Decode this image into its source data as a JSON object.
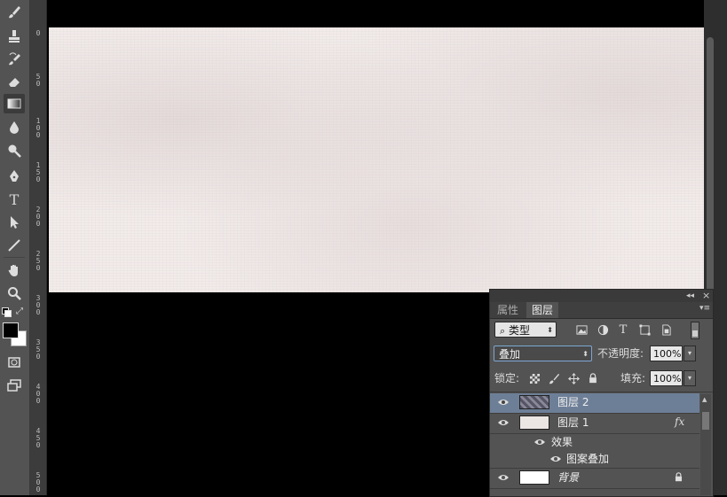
{
  "toolbar": {
    "tools": [
      {
        "name": "brush-tool",
        "icon": "brush-icon"
      },
      {
        "name": "clone-stamp-tool",
        "icon": "stamp-icon"
      },
      {
        "name": "history-brush-tool",
        "icon": "history-brush-icon"
      },
      {
        "name": "eraser-tool",
        "icon": "eraser-icon"
      },
      {
        "name": "gradient-tool",
        "icon": "gradient-icon"
      },
      {
        "name": "blur-tool",
        "icon": "drop-icon"
      },
      {
        "name": "dodge-tool",
        "icon": "dodge-icon"
      },
      {
        "name": "pen-tool",
        "icon": "pen-icon"
      },
      {
        "name": "type-tool",
        "icon": "type-icon",
        "glyph": "T"
      },
      {
        "name": "path-selection-tool",
        "icon": "arrow-icon"
      },
      {
        "name": "line-tool",
        "icon": "line-icon"
      },
      {
        "name": "hand-tool",
        "icon": "hand-icon"
      },
      {
        "name": "zoom-tool",
        "icon": "zoom-icon"
      }
    ]
  },
  "ruler": {
    "labels": [
      "0",
      "50",
      "100",
      "150",
      "200",
      "250",
      "300",
      "350",
      "400",
      "450",
      "500"
    ]
  },
  "layers_panel": {
    "collapse_label": "◂◂",
    "close_label": "×",
    "menu_label": "▾≡",
    "tabs": [
      {
        "label": "属性",
        "active": false
      },
      {
        "label": "图层",
        "active": true
      }
    ],
    "filter": {
      "icon": "search-icon",
      "label": "类型"
    },
    "filter_icons": [
      "image-filter-icon",
      "adjustment-filter-icon",
      "type-filter-icon",
      "shape-filter-icon",
      "smart-object-filter-icon"
    ],
    "blend_mode": "叠加",
    "opacity_label": "不透明度:",
    "opacity_value": "100%",
    "lock_label": "锁定:",
    "fill_label": "填充:",
    "fill_value": "100%",
    "layers": [
      {
        "name": "图层 2",
        "selected": true,
        "visible": true
      },
      {
        "name": "图层 1",
        "selected": false,
        "visible": true,
        "fx": "fx"
      },
      {
        "name": "效果",
        "sub": true
      },
      {
        "name": "图案叠加",
        "sub": true
      },
      {
        "name": "背景",
        "selected": false,
        "visible": true,
        "locked": true
      }
    ]
  },
  "colors": {
    "panel_bg": "#535353",
    "selected_layer": "#6d7f97",
    "canvas_bg": "#f1ebea"
  }
}
